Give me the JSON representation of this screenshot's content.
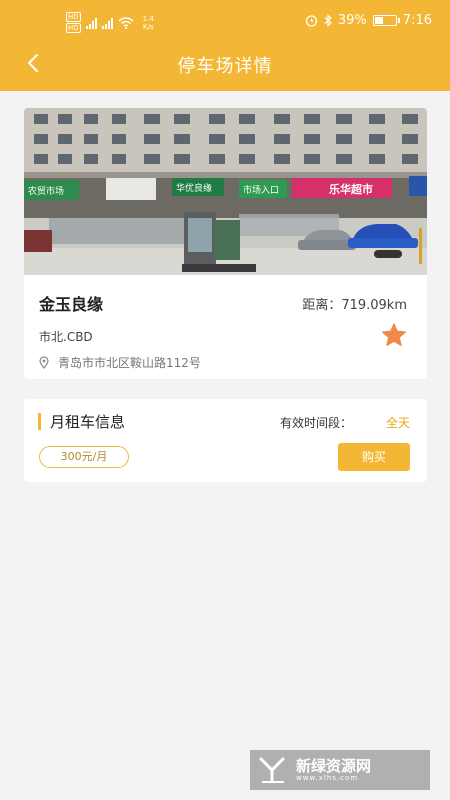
{
  "status_bar": {
    "sim1": "HD",
    "sim2": "HD",
    "net_speed": "1.4",
    "net_unit": "K/s",
    "battery_percent": "39%",
    "time": "7:16",
    "icons": [
      "signal-icon",
      "wifi-icon",
      "alarm-icon",
      "bluetooth-icon",
      "battery-icon"
    ]
  },
  "header": {
    "title": "停车场详情",
    "back_icon": "back-chevron-icon"
  },
  "lot": {
    "photo": {
      "signs": [
        "农贸市场",
        "华优良缘",
        "市场入口",
        "乐华超市"
      ]
    },
    "name": "金玉良缘",
    "distance": "距离：719.09km",
    "district": "市北.CBD",
    "address": "青岛市市北区鞍山路112号",
    "favorite_icon": "star-icon"
  },
  "rent": {
    "title": "月租车信息",
    "period_label": "有效时间段：",
    "period_value": "全天",
    "price": "300元/月",
    "buy_label": "购买"
  },
  "watermark": {
    "text": "新绿资源网",
    "url": "www.xlhs.com"
  },
  "colors": {
    "accent": "#f3b735",
    "background": "#f3f3f3"
  }
}
